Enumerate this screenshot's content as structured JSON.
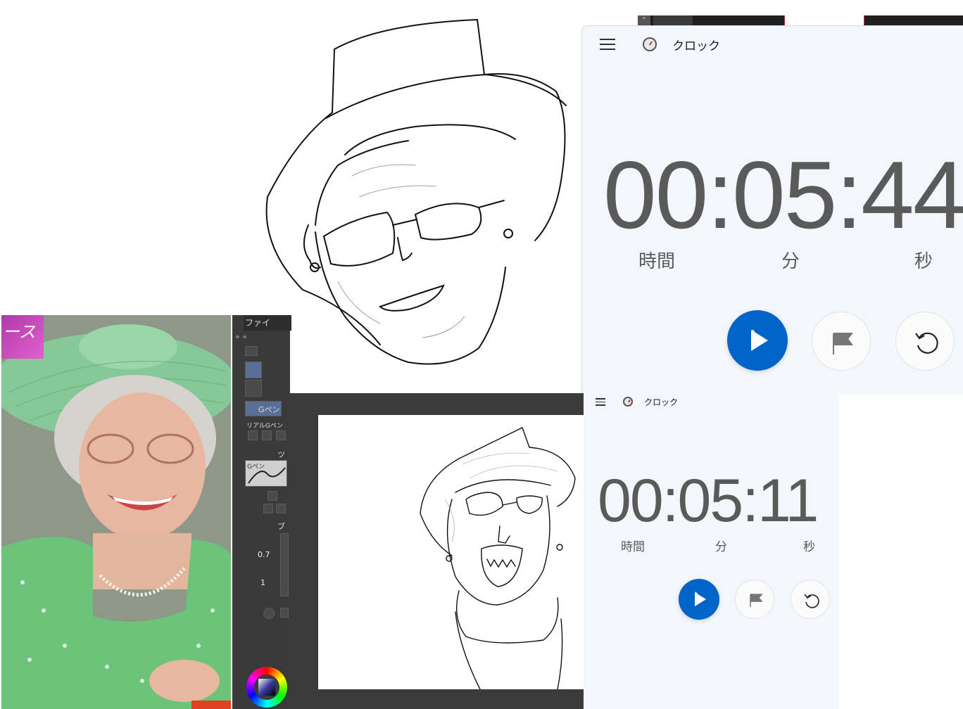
{
  "clock_large": {
    "app_title": "クロック",
    "time": "00:05:44",
    "unit_hours": "時間",
    "unit_minutes": "分",
    "unit_seconds": "秒"
  },
  "clock_small": {
    "app_title": "クロック",
    "time": "00:05:11",
    "unit_hours": "時間",
    "unit_minutes": "分",
    "unit_seconds": "秒"
  },
  "photo_banner": "ース",
  "paint_panel": {
    "menu_label": "ファイ",
    "brush_name": "Gペン",
    "sub_tool": "リアルGペン",
    "preview_label": "Gペン",
    "tool_property_label": "ツ",
    "brush_size_label": "ブ",
    "value_1": "0.7",
    "value_2": "1"
  },
  "colors": {
    "accent": "#0064c8",
    "clock_bg": "#f3f6fa",
    "time_text": "#5a5a5a",
    "panel_bg": "#3a3a3a"
  }
}
